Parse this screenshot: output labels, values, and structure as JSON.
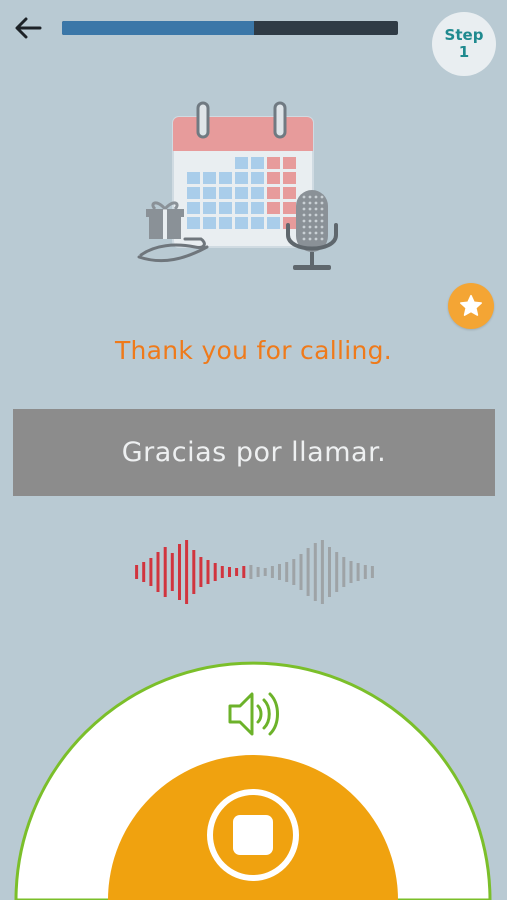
{
  "header": {
    "back_icon": "arrow-left-icon",
    "progress_fraction": 0.57,
    "progress_color": "#3b77a8",
    "step_label": "Step",
    "step_number": "1"
  },
  "illustration": {
    "icon": "calendar-gift-microphone-illustration"
  },
  "favorite": {
    "icon": "star-icon",
    "color": "#f4a534"
  },
  "phrase": {
    "english": "Thank you for calling.",
    "spanish": "Gracias por llamar."
  },
  "playback": {
    "waveform_icon": "audio-waveform-icon",
    "played_color": "#d1343e",
    "unplayed_color": "#9ea3a6"
  },
  "controls": {
    "speaker_icon": "speaker-icon",
    "stop_icon": "stop-icon",
    "accent_color": "#f0a20f",
    "ring_color": "#7bbf2a"
  }
}
